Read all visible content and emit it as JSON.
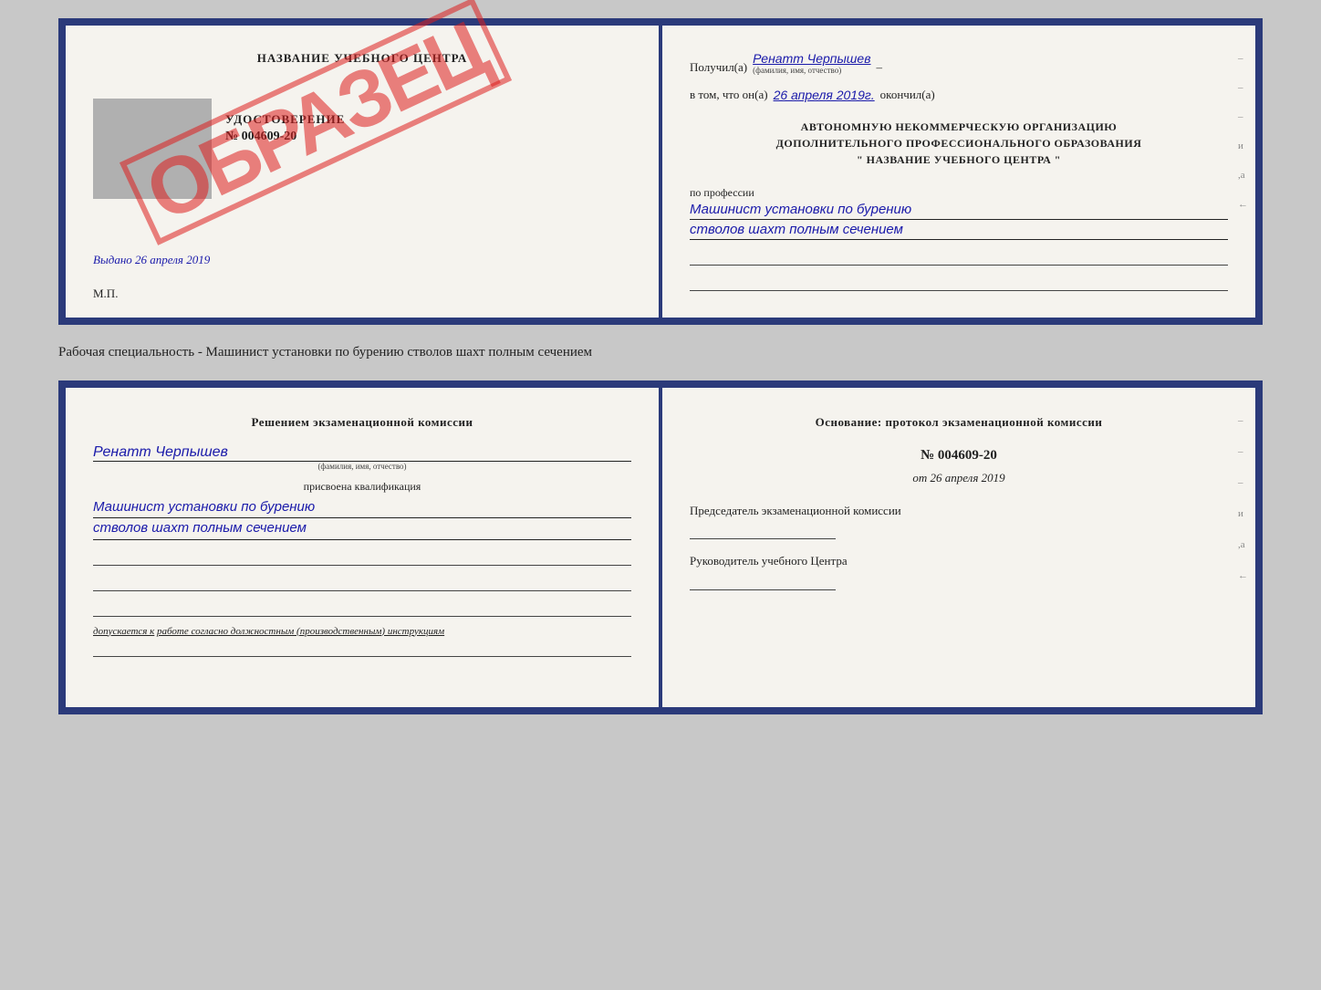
{
  "top_document": {
    "left": {
      "title": "НАЗВАНИЕ УЧЕБНОГО ЦЕНТРА",
      "stamp": "ОБРАЗЕЦ",
      "doc_label": "УДОСТОВЕРЕНИЕ",
      "doc_number": "№ 004609-20",
      "issued_prefix": "Выдано",
      "issued_date": "26 апреля 2019",
      "mp_label": "М.П."
    },
    "right": {
      "received_prefix": "Получил(а)",
      "received_name": "Ренатт Черпышев",
      "name_hint": "(фамилия, имя, отчество)",
      "in_that_prefix": "в том, что он(а)",
      "date_value": "26 апреля 2019г.",
      "finished_suffix": "окончил(а)",
      "org_line1": "АВТОНОМНУЮ НЕКОММЕРЧЕСКУЮ ОРГАНИЗАЦИЮ",
      "org_line2": "ДОПОЛНИТЕЛЬНОГО ПРОФЕССИОНАЛЬНОГО ОБРАЗОВАНИЯ",
      "org_line3": "\"  НАЗВАНИЕ УЧЕБНОГО ЦЕНТРА  \"",
      "profession_label": "по профессии",
      "profession_line1": "Машинист установки по бурению",
      "profession_line2": "стволов шахт полным сечением",
      "dash1": "–",
      "dash2": "–",
      "dash3": "–",
      "letter_i": "и",
      "letter_ia": ",а",
      "arrow": "←"
    }
  },
  "specialty_text": "Рабочая специальность - Машинист установки по бурению стволов шахт полным сечением",
  "bottom_document": {
    "left": {
      "title": "Решением  экзаменационной  комиссии",
      "person_name": "Ренатт Черпышев",
      "name_hint": "(фамилия, имя, отчество)",
      "qualification_prefix": "присвоена квалификация",
      "qualification_line1": "Машинист установки по бурению",
      "qualification_line2": "стволов шахт полным сечением",
      "allowed_prefix": "допускается к",
      "allowed_text": "работе согласно должностным (производственным) инструкциям"
    },
    "right": {
      "basis_label": "Основание: протокол экзаменационной  комиссии",
      "protocol_number": "№  004609-20",
      "date_prefix": "от",
      "date_value": "26 апреля 2019",
      "chairman_label": "Председатель экзаменационной комиссии",
      "rukovoditel_label": "Руководитель учебного Центра",
      "dash1": "–",
      "dash2": "–",
      "dash3": "–",
      "letter_i": "и",
      "letter_ia": ",а",
      "arrow": "←"
    }
  }
}
